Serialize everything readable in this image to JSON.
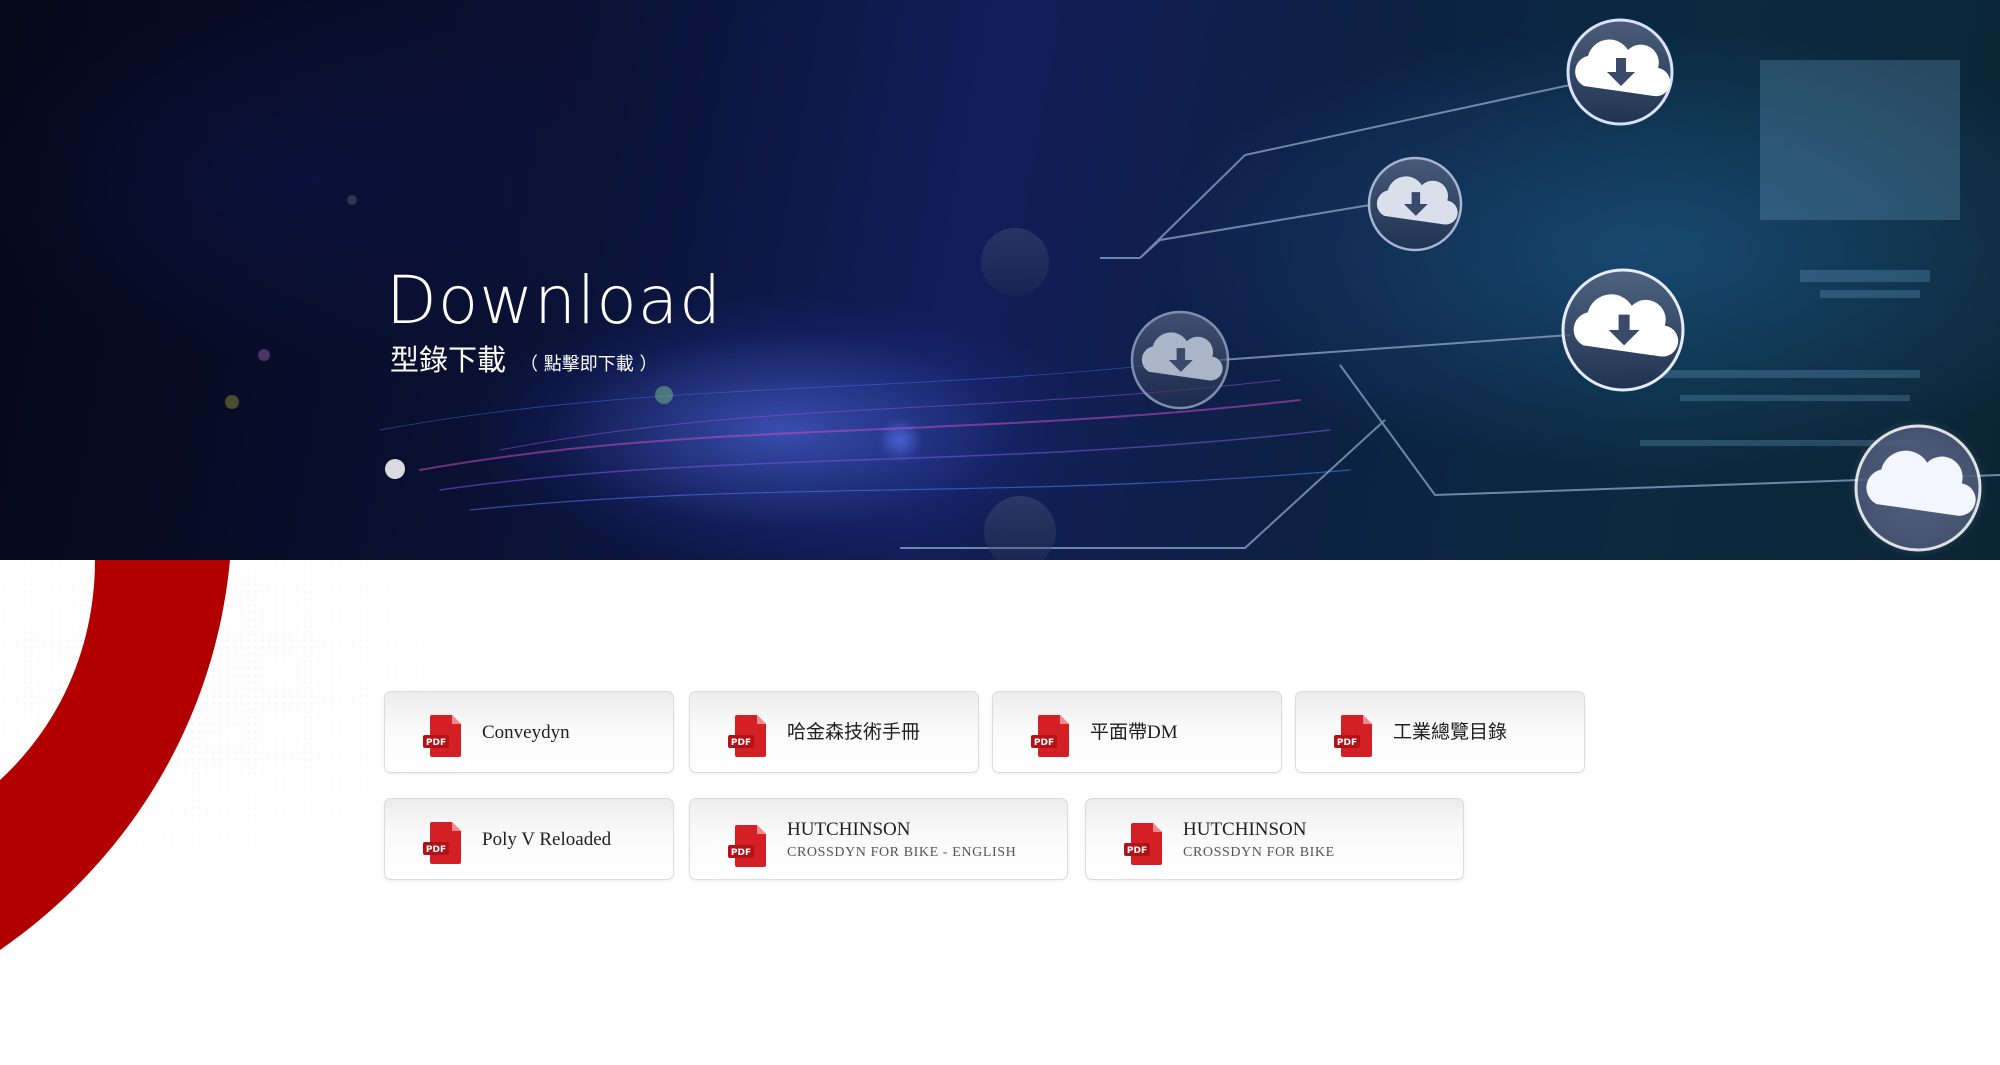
{
  "hero": {
    "title": "Download",
    "subtitle": "型錄下載",
    "note": "（ 點擊即下載 ）"
  },
  "colors": {
    "accent_red": "#b20000",
    "pdf_red": "#d42025",
    "hero_dark": "#0a1236"
  },
  "downloads": [
    {
      "title": "Conveydyn",
      "subtitle": ""
    },
    {
      "title": "哈金森技術手冊",
      "subtitle": ""
    },
    {
      "title": "平面帶DM",
      "subtitle": ""
    },
    {
      "title": "工業總覽目錄",
      "subtitle": ""
    },
    {
      "title": "Poly V Reloaded",
      "subtitle": ""
    },
    {
      "title": "HUTCHINSON",
      "subtitle": "CROSSDYN FOR BIKE - ENGLISH"
    },
    {
      "title": "HUTCHINSON",
      "subtitle": "CROSSDYN FOR BIKE"
    }
  ],
  "icons": {
    "file": "pdf-file-icon",
    "file_text": "PDF",
    "hero": "cloud-download-icon"
  }
}
